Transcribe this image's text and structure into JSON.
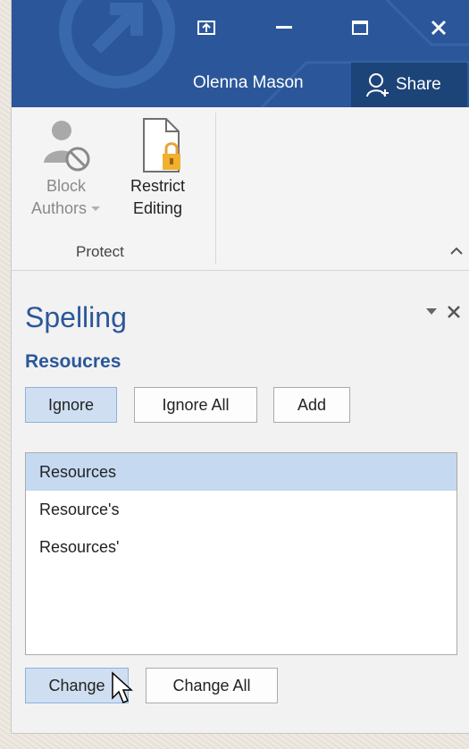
{
  "titlebar": {
    "user_name": "Olenna Mason",
    "share_label": "Share",
    "accent": "#2b579a"
  },
  "ribbon": {
    "block_authors": {
      "line1": "Block",
      "line2": "Authors",
      "disabled": true
    },
    "restrict_editing": {
      "line1": "Restrict",
      "line2": "Editing"
    },
    "group_label": "Protect"
  },
  "spelling": {
    "title": "Spelling",
    "misspelled_word": "Resoucres",
    "ignore_label": "Ignore",
    "ignore_all_label": "Ignore All",
    "add_label": "Add",
    "suggestions": [
      "Resources",
      "Resource's",
      "Resources'"
    ],
    "selected_suggestion": "Resources",
    "change_label": "Change",
    "change_all_label": "Change All"
  },
  "icons": {
    "window": [
      "restore-ribbon-icon",
      "minimize-icon",
      "maximize-icon",
      "close-icon"
    ],
    "share": "person-add-icon",
    "block_authors": "block-authors-icon",
    "restrict_editing": "lock-document-icon",
    "pane": [
      "dropdown-icon",
      "close-pane-icon"
    ]
  }
}
